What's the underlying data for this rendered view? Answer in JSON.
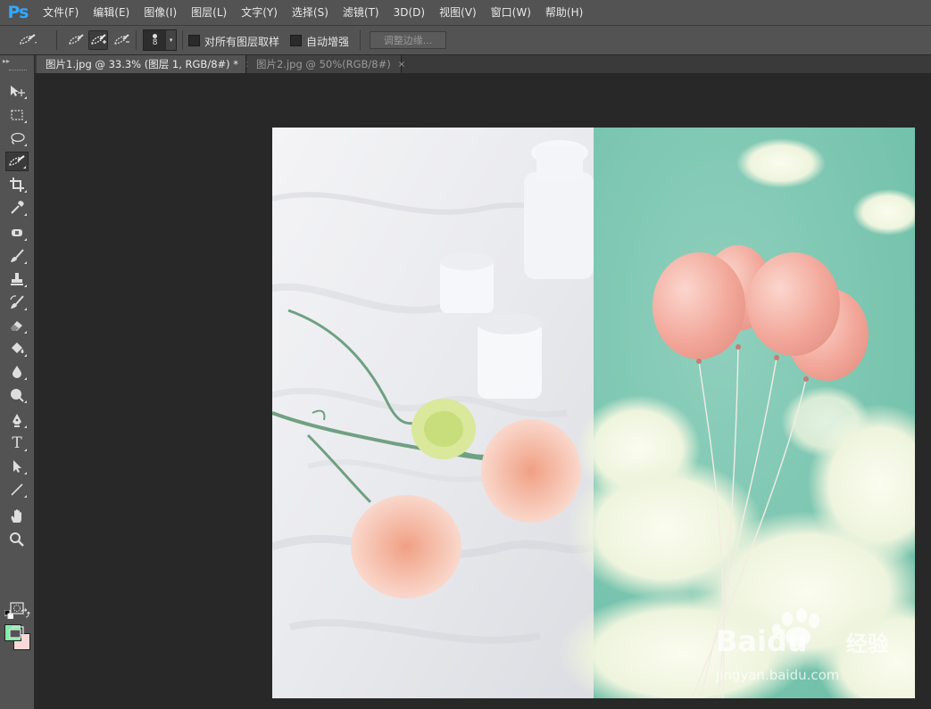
{
  "app": {
    "logo": "Ps"
  },
  "menu": [
    "文件(F)",
    "编辑(E)",
    "图像(I)",
    "图层(L)",
    "文字(Y)",
    "选择(S)",
    "滤镜(T)",
    "3D(D)",
    "视图(V)",
    "窗口(W)",
    "帮助(H)"
  ],
  "options": {
    "brush_size": "8",
    "sample_all_layers_label": "对所有图层取样",
    "auto_enhance_label": "自动增强",
    "refine_edge_label": "调整边缘..."
  },
  "tabs": [
    {
      "label": "图片1.jpg @ 33.3% (图层 1, RGB/8#) *",
      "close": "×",
      "active": true
    },
    {
      "label": "图片2.jpg @ 50%(RGB/8#)",
      "close": "×",
      "active": false
    }
  ],
  "toolbox": {
    "foreground_color": "#80f0a8",
    "background_color": "#f8d8d8",
    "text_tool_glyph": "T",
    "tools": [
      "move-tool",
      "marquee-tool",
      "lasso-tool",
      "quick-selection-tool",
      "crop-tool",
      "eyedropper-tool",
      "spot-healing-tool",
      "brush-tool",
      "clone-stamp-tool",
      "history-brush-tool",
      "eraser-tool",
      "paint-bucket-tool",
      "blur-tool",
      "dodge-tool",
      "pen-tool",
      "type-tool",
      "path-selection-tool",
      "line-tool",
      "hand-tool",
      "zoom-tool"
    ]
  },
  "watermark": {
    "brand": "Baidu",
    "brand_cn": "经验",
    "url": "jingyan.baidu.com"
  }
}
